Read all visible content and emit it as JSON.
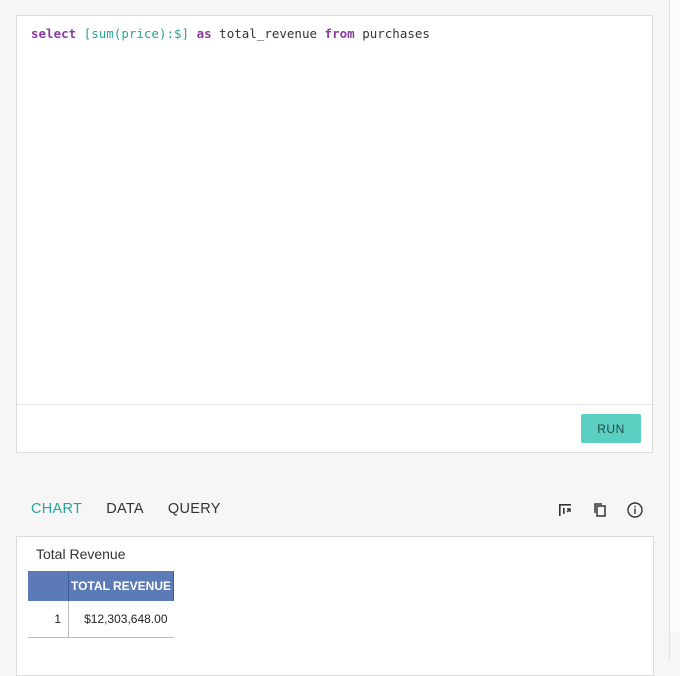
{
  "editor": {
    "query_tokens": {
      "select": "select",
      "expr": "[sum(price):$]",
      "as": "as",
      "alias": "total_revenue",
      "from": "from",
      "table": "purchases"
    },
    "run_label": "RUN"
  },
  "tabs": [
    {
      "label": "CHART",
      "active": true
    },
    {
      "label": "DATA",
      "active": false
    },
    {
      "label": "QUERY",
      "active": false
    }
  ],
  "toolbar": {
    "icons": [
      "chart-settings-icon",
      "copy-icon",
      "info-icon"
    ]
  },
  "result": {
    "title": "Total Revenue",
    "table": {
      "header_index": "",
      "columns": [
        "TOTAL REVENUE"
      ],
      "rows": [
        {
          "index": "1",
          "values": [
            "$12,303,648.00"
          ]
        }
      ]
    }
  },
  "colors": {
    "accent": "#26a69a",
    "run_button": "#5bcfc2",
    "table_header": "#5b7ab6",
    "keyword": "#8a3c9e",
    "function": "#2aa198"
  }
}
